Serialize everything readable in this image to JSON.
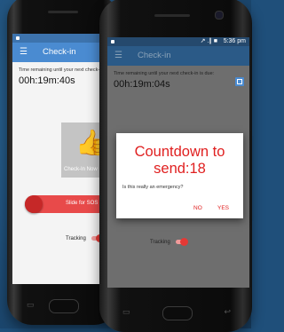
{
  "back_phone": {
    "app_title": "Check-in",
    "remaining_label": "Time remaining until your next check-in is due:",
    "timer": "00h:19m:40s",
    "checkin_button_label": "Check-In Now",
    "sos_label": "Slide for SOS",
    "tracking_label": "Tracking"
  },
  "front_phone": {
    "status_time": "5:36 pm",
    "status_icons": "↗ .∥ ■",
    "app_title": "Check-in",
    "remaining_label": "Time remaining until your next check-in is due:",
    "timer": "00h:19m:04s",
    "tracking_label": "Tracking"
  },
  "dialog": {
    "title": "Countdown to send:18",
    "message": "Is this really an emergency?",
    "no_label": "NO",
    "yes_label": "YES"
  },
  "icons": {
    "menu": "hamburger-icon",
    "thumb": "thumbs-up-icon",
    "calendar": "calendar-icon"
  },
  "colors": {
    "appbar": "#4a8bd1",
    "sos": "#e84a4a",
    "dialog_accent": "#e02020",
    "background": "#1f4f7a"
  }
}
